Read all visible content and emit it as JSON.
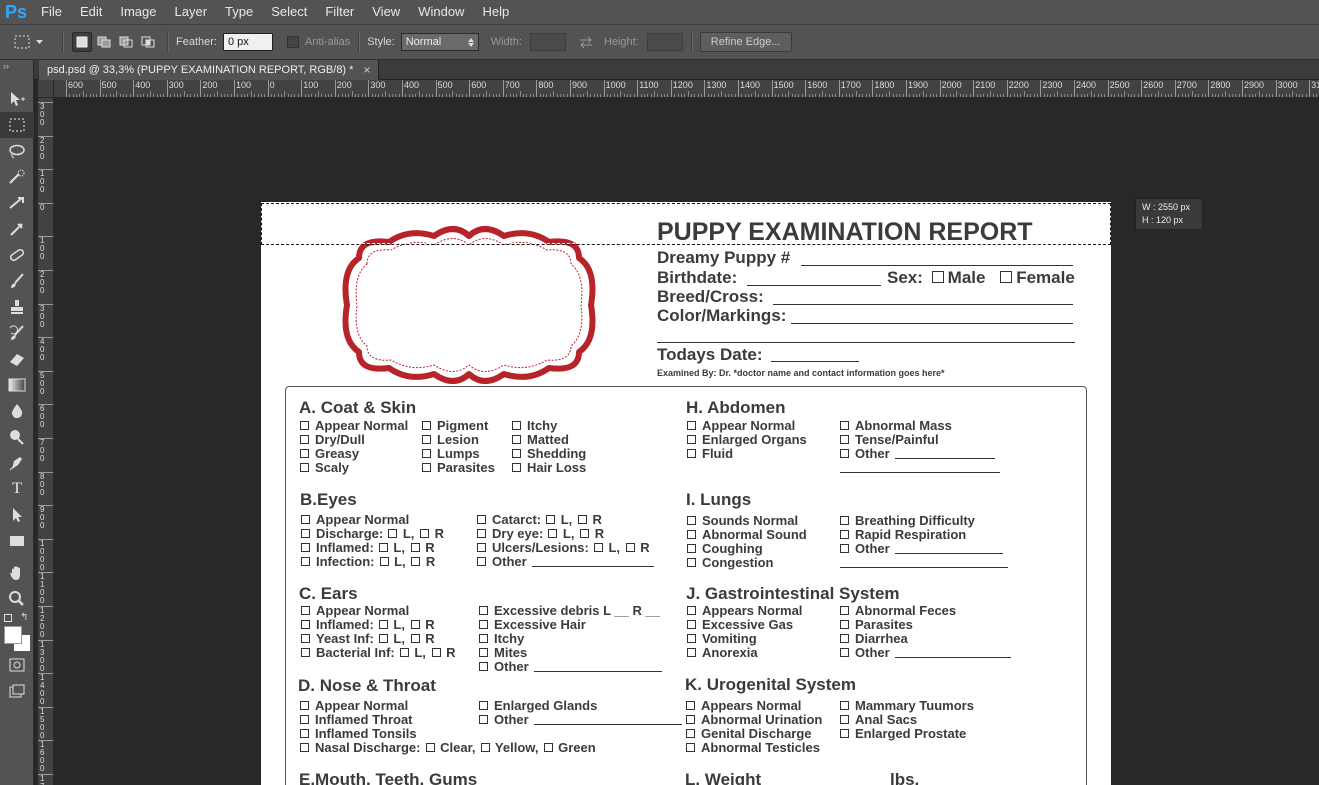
{
  "app": {
    "logo": "Ps"
  },
  "menu": [
    "File",
    "Edit",
    "Image",
    "Layer",
    "Type",
    "Select",
    "Filter",
    "View",
    "Window",
    "Help"
  ],
  "options": {
    "feather_label": "Feather:",
    "feather_value": "0 px",
    "antialias_label": "Anti-alias",
    "style_label": "Style:",
    "style_value": "Normal",
    "width_label": "Width:",
    "height_label": "Height:",
    "refine_edge": "Refine Edge..."
  },
  "tab": {
    "title": "psd.psd @ 33,3% (PUPPY EXAMINATION REPORT, RGB/8) *",
    "close": "×"
  },
  "ruler": {
    "h_ticks": [
      "600",
      "500",
      "400",
      "300",
      "200",
      "100",
      "0",
      "100",
      "200",
      "300",
      "400",
      "500",
      "600",
      "700",
      "800",
      "900",
      "1000",
      "1100",
      "1200",
      "1300",
      "1400",
      "1500",
      "1600",
      "1700",
      "1800",
      "1900",
      "2000",
      "2100",
      "2200",
      "2300",
      "2400",
      "2500",
      "2600",
      "2700",
      "2800",
      "2900",
      "3000",
      "3100"
    ],
    "v_ticks": [
      "3 0 0",
      "2 0 0",
      "1 0 0",
      "0",
      "1 0 0",
      "2 0 0",
      "3 0 0",
      "4 0 0",
      "5 0 0",
      "6 0 0",
      "7 0 0",
      "8 0 0",
      "9 0 0",
      "1 0 0 0",
      "1 1 0 0",
      "1 2 0 0",
      "1 3 0 0",
      "1 4 0 0",
      "1 5 0 0",
      "1 6 0 0",
      "1 7 0 0"
    ]
  },
  "selection_info": {
    "w": "W :   2550 px",
    "h": "H :    120 px"
  },
  "colors": {
    "ui_bg": "#535353",
    "canvas_bg": "#282828",
    "label_frame": "#b8232a",
    "ps_blue": "#31a8ff"
  },
  "document": {
    "title": "PUPPY EXAMINATION REPORT",
    "dreamy_puppy": "Dreamy Puppy #",
    "birthdate": "Birthdate:",
    "sex": "Sex:",
    "male": "Male",
    "female": "Female",
    "breed": "Breed/Cross:",
    "color": "Color/Markings:",
    "todays_date": "Todays Date:",
    "examined_by": "Examined By: Dr. *doctor name and contact information goes here*",
    "sections": {
      "A": {
        "title": "A. Coat & Skin",
        "col1": [
          "Appear Normal",
          "Dry/Dull",
          "Greasy",
          "Scaly"
        ],
        "col2": [
          "Pigment",
          "Lesion",
          "Lumps",
          "Parasites"
        ],
        "col3": [
          "Itchy",
          "Matted",
          "Shedding",
          "Hair Loss"
        ]
      },
      "B": {
        "title": "B.Eyes",
        "col1": [
          "Appear Normal",
          "Discharge:",
          "Inflamed:",
          "Infection:"
        ],
        "col2": [
          "Catarct:",
          "Dry eye:",
          "Ulcers/Lesions:",
          "Other"
        ]
      },
      "C": {
        "title": "C. Ears",
        "col1": [
          "Appear Normal",
          "Inflamed:",
          "Yeast Inf:",
          "Bacterial Inf:"
        ],
        "col2": [
          "Excessive debris L __ R __",
          "Excessive Hair",
          "Itchy",
          "Mites",
          "Other"
        ]
      },
      "D": {
        "title": "D. Nose & Throat",
        "col1": [
          "Appear Normal",
          "Inflamed Throat",
          "Inflamed Tonsils",
          "Nasal Discharge:"
        ],
        "col2": [
          "Enlarged Glands",
          "Other"
        ],
        "nasal_opts": [
          "Clear,",
          "Yellow,",
          "Green"
        ]
      },
      "E": {
        "title": "E.Mouth, Teeth, Gums"
      },
      "H": {
        "title": "H. Abdomen",
        "col1": [
          "Appear Normal",
          "Enlarged Organs",
          "Fluid"
        ],
        "col2": [
          "Abnormal Mass",
          "Tense/Painful",
          "Other"
        ]
      },
      "I": {
        "title": "I. Lungs",
        "col1": [
          "Sounds Normal",
          "Abnormal  Sound",
          "Coughing",
          "Congestion"
        ],
        "col2": [
          "Breathing Difficulty",
          "Rapid Respiration",
          "Other"
        ]
      },
      "J": {
        "title": "J. Gastrointestinal System",
        "col1": [
          "Appears Normal",
          "Excessive Gas",
          "Vomiting",
          "Anorexia"
        ],
        "col2": [
          "Abnormal Feces",
          "Parasites",
          "Diarrhea",
          "Other"
        ]
      },
      "K": {
        "title": "K. Urogenital System",
        "col1": [
          "Appears Normal",
          "Abnormal Urination",
          "Genital Discharge",
          "Abnormal Testicles"
        ],
        "col2": [
          "Mammary Tuumors",
          "Anal Sacs",
          "Enlarged Prostate"
        ]
      },
      "L": {
        "title": "L. Weight",
        "unit": "lbs."
      }
    },
    "lr": "L,",
    "r": "R"
  }
}
